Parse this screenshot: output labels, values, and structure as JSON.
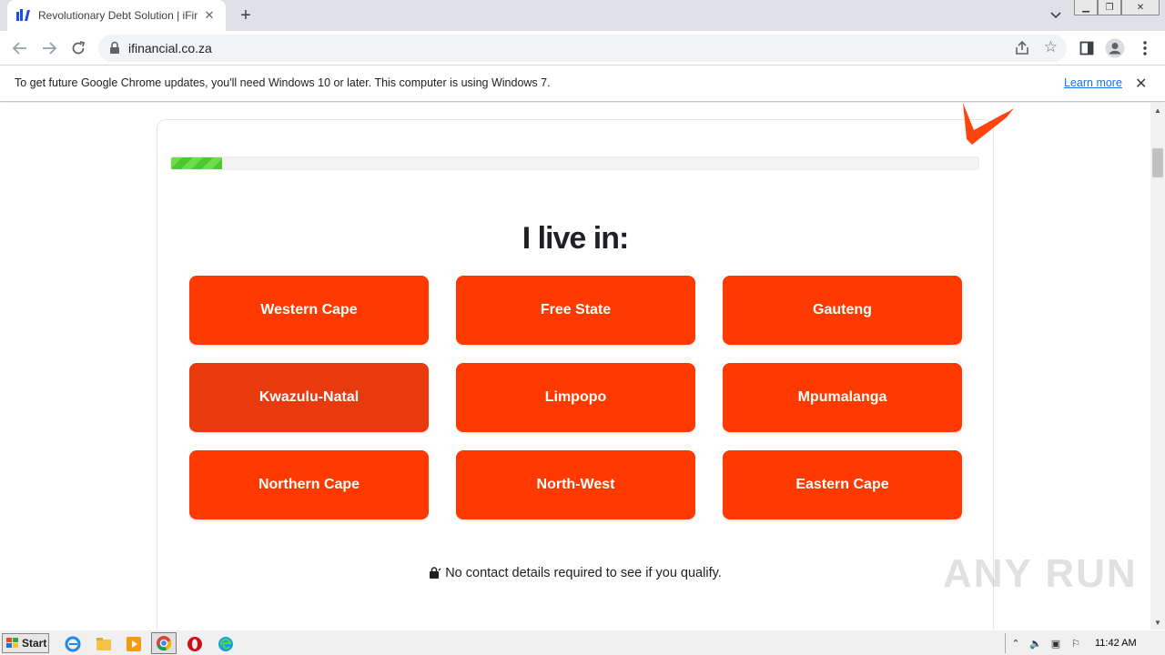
{
  "browser": {
    "tab": {
      "title": "Revolutionary Debt Solution | iFinancial"
    },
    "url": "ifinancial.co.za"
  },
  "infobar": {
    "message": "To get future Google Chrome updates, you'll need Windows 10 or later. This computer is using Windows 7.",
    "link": "Learn more"
  },
  "page": {
    "progress_percent": 6.3,
    "question": "I live in:",
    "options": [
      "Western Cape",
      "Free State",
      "Gauteng",
      "Kwazulu-Natal",
      "Limpopo",
      "Mpumalanga",
      "Northern Cape",
      "North-West",
      "Eastern Cape"
    ],
    "note": "No contact details required to see if you qualify.",
    "accent_color": "#ff3a00"
  },
  "watermark": "ANY RUN",
  "taskbar": {
    "start_label": "Start",
    "clock": "11:42 AM"
  }
}
